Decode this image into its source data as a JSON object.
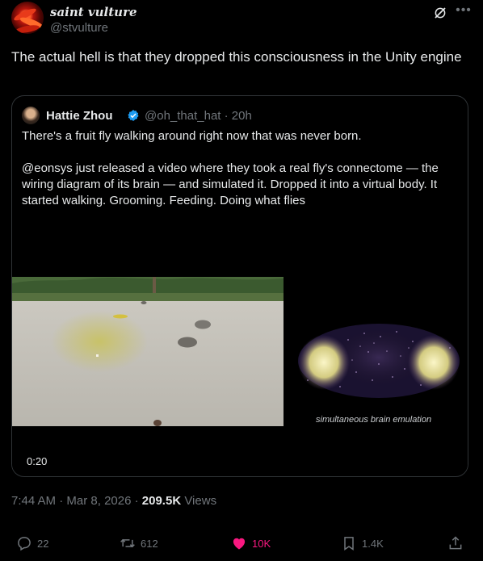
{
  "tweet": {
    "author": {
      "display_name": "saint vulture",
      "handle": "@stvulture"
    },
    "text": "The actual hell is that they dropped this consciousness in the Unity engine",
    "timestamp": "7:44 AM",
    "date": "Mar 8, 2026",
    "views_count": "209.5K",
    "views_label": "Views",
    "separator": "·"
  },
  "quoted": {
    "author": {
      "display_name": "Hattie Zhou",
      "handle_time": "@oh_that_hat · 20h"
    },
    "paragraphs": [
      "There's a fruit fly walking around right now that was never born.",
      "@eonsys just released a video where they took a real fly's connectome — the wiring diagram of its brain — and simulated it. Dropped it into a virtual body. It started walking. Grooming. Feeding. Doing what flies"
    ],
    "video": {
      "caption": "simultaneous brain emulation",
      "duration": "0:20"
    }
  },
  "actions": {
    "reply_count": "22",
    "retweet_count": "612",
    "like_count": "10K",
    "bookmark_count": "1.4K"
  },
  "colors": {
    "background": "#000000",
    "text": "#e7e9ea",
    "muted": "#71767b",
    "border": "#2f3336",
    "like": "#f91880",
    "verified": "#1d9bf0"
  },
  "icons": [
    "grok-icon",
    "more-icon",
    "verified-icon",
    "reply-icon",
    "retweet-icon",
    "like-icon",
    "bookmark-icon",
    "share-icon"
  ]
}
